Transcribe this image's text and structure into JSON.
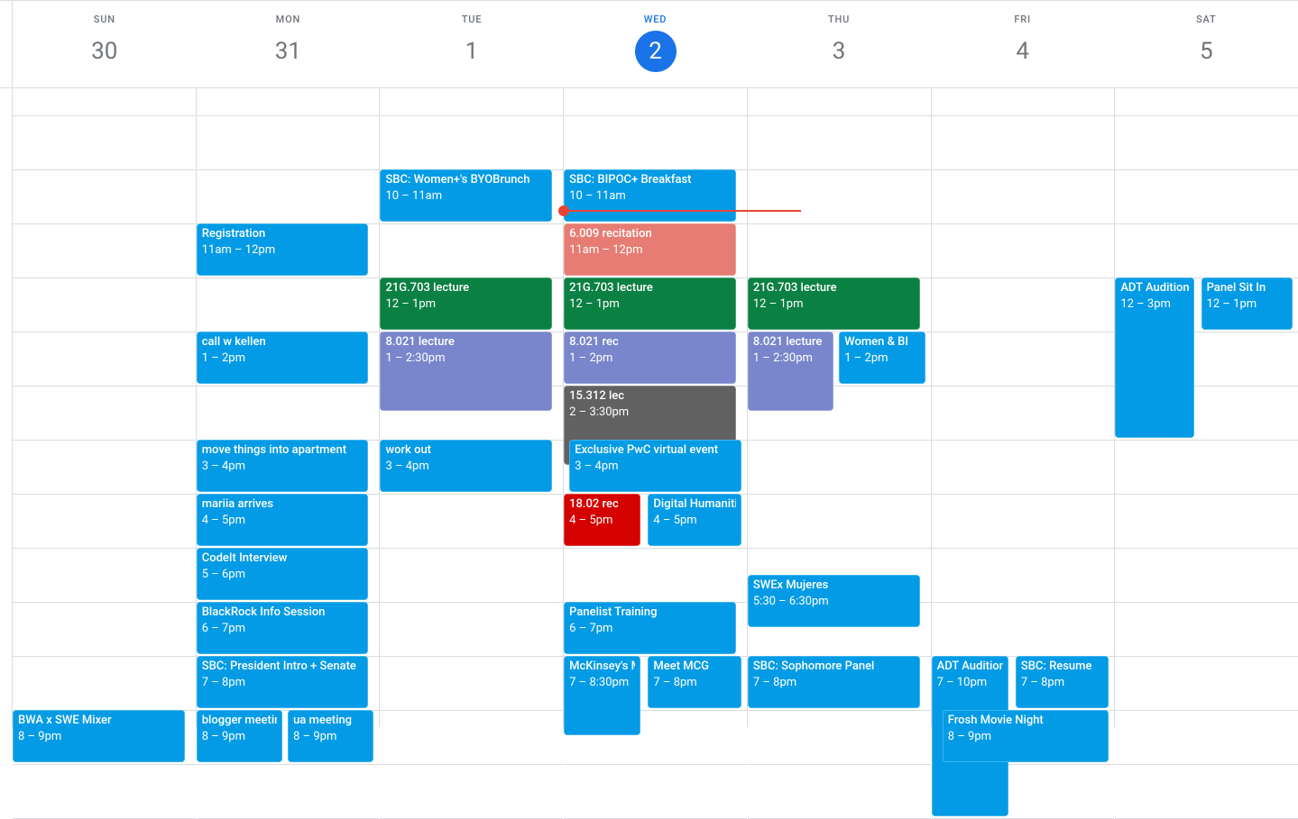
{
  "hourHeight": 60,
  "startHour": 8.5,
  "nowHour": 10.75,
  "todayIndex": 3,
  "days": [
    {
      "abbr": "SUN",
      "num": "30"
    },
    {
      "abbr": "MON",
      "num": "31"
    },
    {
      "abbr": "TUE",
      "num": "1"
    },
    {
      "abbr": "WED",
      "num": "2"
    },
    {
      "abbr": "THU",
      "num": "3"
    },
    {
      "abbr": "FRI",
      "num": "4"
    },
    {
      "abbr": "SAT",
      "num": "5"
    }
  ],
  "colors": {
    "blue": "#039be5",
    "green": "#0b8043",
    "purple": "#7986cb",
    "grey": "#616161",
    "red": "#d50000",
    "salmon": "#e67c73"
  },
  "events": [
    {
      "day": 0,
      "start": 20,
      "end": 21,
      "title": "BWA x SWE Mixer",
      "time": "8 – 9pm",
      "color": "blue"
    },
    {
      "day": 1,
      "start": 11,
      "end": 12,
      "title": "Registration",
      "time": "11am – 12pm",
      "color": "blue"
    },
    {
      "day": 1,
      "start": 13,
      "end": 14,
      "title": "call w kellen",
      "time": "1 – 2pm",
      "color": "blue"
    },
    {
      "day": 1,
      "start": 15,
      "end": 16,
      "title": "move things into apartment",
      "time": "3 – 4pm",
      "color": "blue"
    },
    {
      "day": 1,
      "start": 16,
      "end": 17,
      "title": "mariia arrives",
      "time": "4 – 5pm",
      "color": "blue"
    },
    {
      "day": 1,
      "start": 17,
      "end": 18,
      "title": "CodeIt Interview",
      "time": "5 – 6pm",
      "color": "blue"
    },
    {
      "day": 1,
      "start": 18,
      "end": 19,
      "title": "BlackRock Info Session",
      "time": "6 – 7pm",
      "color": "blue"
    },
    {
      "day": 1,
      "start": 19,
      "end": 20,
      "title": "SBC: President Intro + Senate",
      "time": "7 – 8pm",
      "color": "blue"
    },
    {
      "day": 1,
      "start": 20,
      "end": 21,
      "title": "blogger meeting",
      "time": "8 – 9pm",
      "color": "blue",
      "left": 0,
      "right": 0.5
    },
    {
      "day": 1,
      "start": 20,
      "end": 21,
      "title": "ua meeting",
      "time": "8 – 9pm",
      "color": "blue",
      "left": 0.5,
      "right": 1
    },
    {
      "day": 2,
      "start": 10,
      "end": 11,
      "title": "SBC: Women+'s BYOBrunch",
      "time": "10 – 11am",
      "color": "blue"
    },
    {
      "day": 2,
      "start": 12,
      "end": 13,
      "title": "21G.703 lecture",
      "time": "12 – 1pm",
      "color": "green"
    },
    {
      "day": 2,
      "start": 13,
      "end": 14.5,
      "title": "8.021 lecture",
      "time": "1 – 2:30pm",
      "color": "purple"
    },
    {
      "day": 2,
      "start": 15,
      "end": 16,
      "title": "work out",
      "time": "3 – 4pm",
      "color": "blue"
    },
    {
      "day": 3,
      "start": 10,
      "end": 11,
      "title": "SBC: BIPOC+ Breakfast",
      "time": "10 – 11am",
      "color": "blue"
    },
    {
      "day": 3,
      "start": 11,
      "end": 12,
      "title": "6.009 recitation",
      "time": "11am – 12pm",
      "color": "salmon"
    },
    {
      "day": 3,
      "start": 12,
      "end": 13,
      "title": "21G.703 lecture",
      "time": "12 – 1pm",
      "color": "green"
    },
    {
      "day": 3,
      "start": 13,
      "end": 14,
      "title": "8.021 rec",
      "time": "1 – 2pm",
      "color": "purple"
    },
    {
      "day": 3,
      "start": 14,
      "end": 15.5,
      "title": "15.312 lec",
      "time": "2 – 3:30pm",
      "color": "grey"
    },
    {
      "day": 3,
      "start": 15,
      "end": 16,
      "title": "Exclusive PwC virtual event",
      "time": "3 – 4pm",
      "color": "blue",
      "left": 0.03
    },
    {
      "day": 3,
      "start": 16,
      "end": 17,
      "title": "18.02 rec",
      "time": "4 – 5pm",
      "color": "red",
      "left": 0,
      "right": 0.45
    },
    {
      "day": 3,
      "start": 16,
      "end": 17,
      "title": "Digital Humanities",
      "time": "4 – 5pm",
      "color": "blue",
      "left": 0.46,
      "right": 1
    },
    {
      "day": 3,
      "start": 18,
      "end": 19,
      "title": "Panelist Training",
      "time": "6 – 7pm",
      "color": "blue"
    },
    {
      "day": 3,
      "start": 19,
      "end": 20.5,
      "title": "McKinsey's Marketing & Sales Practice Session",
      "time": "7 – 8:30pm",
      "color": "blue",
      "left": 0,
      "right": 0.45
    },
    {
      "day": 3,
      "start": 19,
      "end": 20,
      "title": "Meet MCG",
      "time": "7 – 8pm",
      "color": "blue",
      "left": 0.46,
      "right": 1
    },
    {
      "day": 4,
      "start": 12,
      "end": 13,
      "title": "21G.703 lecture",
      "time": "12 – 1pm",
      "color": "green"
    },
    {
      "day": 4,
      "start": 13,
      "end": 14.5,
      "title": "8.021 lecture",
      "time": "1 – 2:30pm",
      "color": "purple",
      "left": 0,
      "right": 0.5
    },
    {
      "day": 4,
      "start": 13,
      "end": 14,
      "title": "Women & BI",
      "time": "1 – 2pm",
      "color": "blue",
      "left": 0.5,
      "right": 1
    },
    {
      "day": 4,
      "start": 17.5,
      "end": 18.5,
      "title": "SWEx Mujeres",
      "time": "5:30 – 6:30pm",
      "color": "blue"
    },
    {
      "day": 4,
      "start": 19,
      "end": 20,
      "title": "SBC: Sophomore Panel",
      "time": "7 – 8pm",
      "color": "blue"
    },
    {
      "day": 5,
      "start": 19,
      "end": 22,
      "title": "ADT Auditions",
      "time": "7 – 10pm",
      "color": "blue",
      "left": 0,
      "right": 0.45
    },
    {
      "day": 5,
      "start": 19,
      "end": 20,
      "title": "SBC: Resume",
      "time": "7 – 8pm",
      "color": "blue",
      "left": 0.46,
      "right": 1
    },
    {
      "day": 5,
      "start": 20,
      "end": 21,
      "title": "Frosh Movie Night",
      "time": "8 – 9pm",
      "color": "blue",
      "left": 0.06
    },
    {
      "day": 6,
      "start": 12,
      "end": 15,
      "title": "ADT Auditions",
      "time": "12 – 3pm",
      "color": "blue",
      "left": 0,
      "right": 0.46
    },
    {
      "day": 6,
      "start": 12,
      "end": 13,
      "title": "Panel Sit In",
      "time": "12 – 1pm",
      "color": "blue",
      "left": 0.47,
      "right": 1
    }
  ]
}
